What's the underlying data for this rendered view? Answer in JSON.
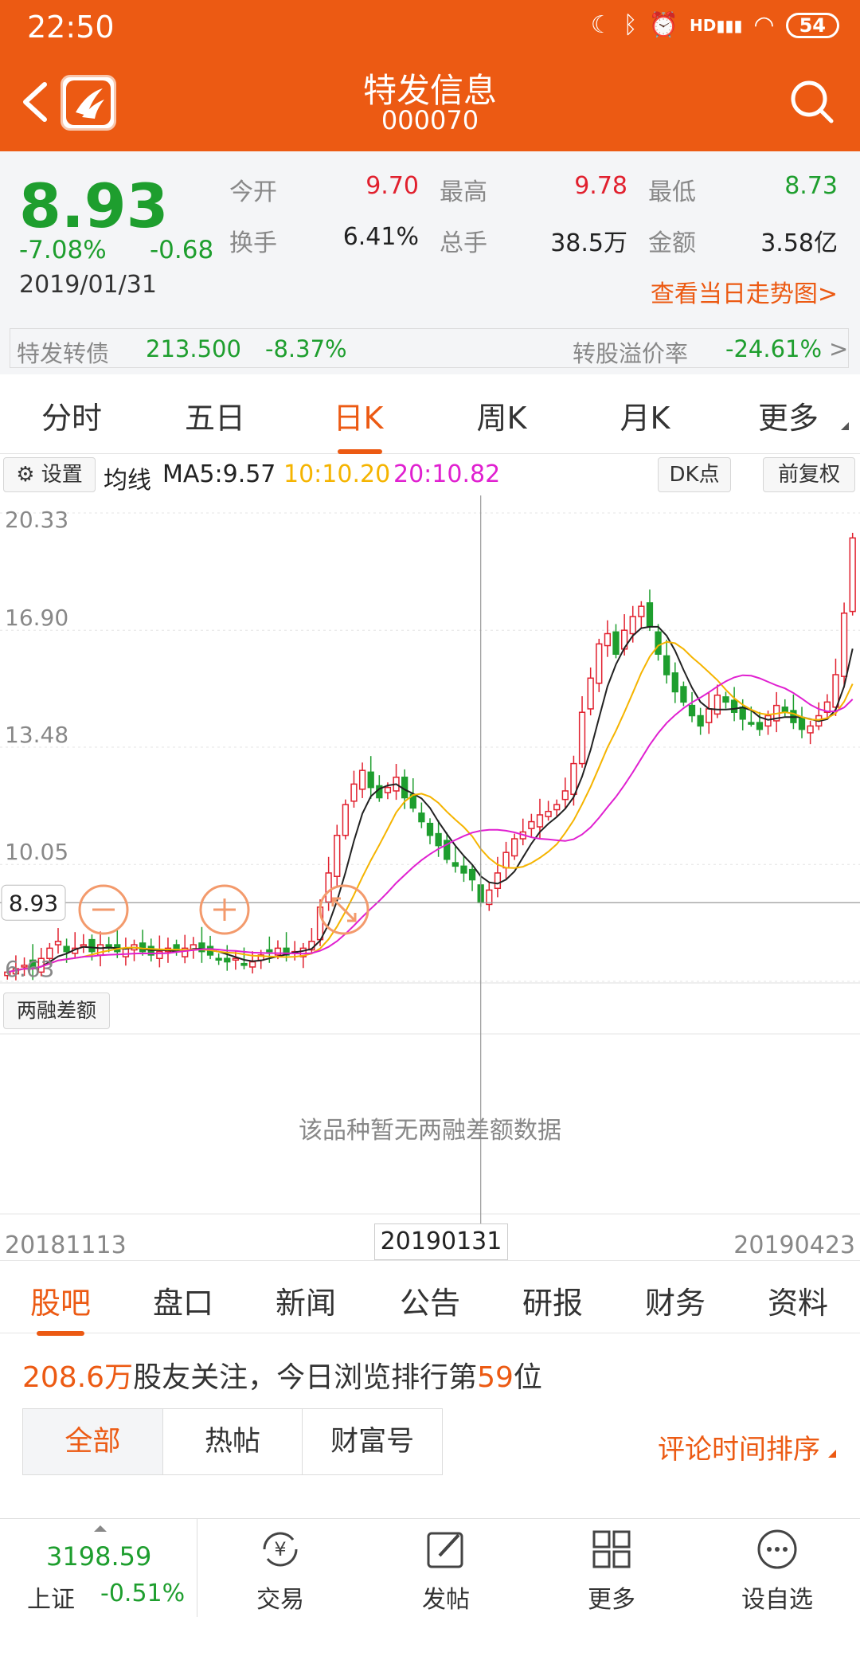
{
  "status": {
    "time": "22:50",
    "battery": "54",
    "signal_label": "HD"
  },
  "header": {
    "title": "特发信息",
    "code": "000070"
  },
  "quote": {
    "price": "8.93",
    "change_pct": "-7.08%",
    "change_val": "-0.68",
    "date": "2019/01/31",
    "open_label": "今开",
    "open": "9.70",
    "high_label": "最高",
    "high": "9.78",
    "low_label": "最低",
    "low": "8.73",
    "turnover_label": "换手",
    "turnover": "6.41%",
    "volume_label": "总手",
    "volume": "38.5万",
    "amount_label": "金额",
    "amount": "3.58亿",
    "trend_link": "查看当日走势图>"
  },
  "bond": {
    "name": "特发转债",
    "price": "213.500",
    "change": "-8.37%",
    "premium_label": "转股溢价率",
    "premium": "-24.61%",
    "arrow": ">"
  },
  "chart_tabs": [
    {
      "label": "分时"
    },
    {
      "label": "五日"
    },
    {
      "label": "日K"
    },
    {
      "label": "周K"
    },
    {
      "label": "月K"
    },
    {
      "label": "更多"
    }
  ],
  "ma": {
    "settings": "设置",
    "title": "均线",
    "ma5": "MA5:9.57",
    "ma10": "10:10.20",
    "ma20": "20:10.82",
    "dk": "DK点",
    "adjust": "前复权"
  },
  "margin": {
    "label": "两融差额",
    "empty": "该品种暂无两融差额数据"
  },
  "chart_data": {
    "type": "candlestick",
    "y_ticks": [
      "20.33",
      "16.90",
      "13.48",
      "10.05",
      "6.63"
    ],
    "ylim": [
      6.63,
      20.33
    ],
    "current_price": "8.93",
    "x_start": "20181113",
    "x_current": "20190131",
    "x_end": "20190423",
    "colors": {
      "up": "#e1202e",
      "down": "#1e9e2e",
      "ma5": "#222222",
      "ma10": "#f5b400",
      "ma20": "#e020d0"
    },
    "close": [
      6.9,
      7.0,
      7.1,
      7.0,
      7.3,
      7.6,
      7.8,
      7.5,
      7.6,
      7.7,
      7.5,
      7.7,
      7.6,
      7.5,
      7.6,
      7.7,
      7.5,
      7.4,
      7.5,
      7.6,
      7.5,
      7.6,
      7.7,
      7.5,
      7.4,
      7.3,
      7.2,
      7.3,
      7.1,
      7.2,
      7.4,
      7.5,
      7.6,
      7.4,
      7.5,
      7.6,
      7.8,
      8.8,
      9.8,
      10.9,
      11.8,
      12.4,
      12.8,
      12.3,
      12.0,
      12.3,
      12.6,
      12.0,
      11.7,
      11.3,
      10.9,
      10.6,
      10.2,
      10.0,
      9.8,
      9.6,
      8.93,
      9.3,
      9.8,
      10.4,
      10.8,
      11.0,
      11.3,
      11.5,
      11.6,
      11.8,
      12.2,
      13.0,
      14.5,
      15.5,
      16.5,
      16.8,
      16.2,
      16.9,
      17.3,
      17.6,
      17.0,
      16.2,
      15.6,
      15.1,
      14.8,
      14.4,
      14.1,
      14.6,
      15.0,
      14.8,
      14.5,
      14.3,
      14.2,
      14.0,
      14.4,
      14.7,
      14.5,
      14.2,
      14.0,
      14.1,
      14.4,
      14.8,
      15.6,
      17.4,
      19.6
    ]
  },
  "info_tabs": [
    {
      "label": "股吧"
    },
    {
      "label": "盘口"
    },
    {
      "label": "新闻"
    },
    {
      "label": "公告"
    },
    {
      "label": "研报"
    },
    {
      "label": "财务"
    },
    {
      "label": "资料"
    }
  ],
  "follow": {
    "count": "208.6万",
    "text1": "股友关注，今日浏览排行第",
    "rank": "59",
    "text2": "位"
  },
  "filters": [
    {
      "label": "全部"
    },
    {
      "label": "热帖"
    },
    {
      "label": "财富号"
    }
  ],
  "sort": {
    "label": "评论时间排序"
  },
  "index": {
    "value": "3198.59",
    "name": "上证",
    "change": "-0.51%"
  },
  "bottom_nav": [
    {
      "label": "交易",
      "icon": "yen-refresh-icon"
    },
    {
      "label": "发帖",
      "icon": "compose-icon"
    },
    {
      "label": "更多",
      "icon": "grid-icon"
    },
    {
      "label": "设自选",
      "icon": "ellipsis-circle-icon"
    }
  ]
}
